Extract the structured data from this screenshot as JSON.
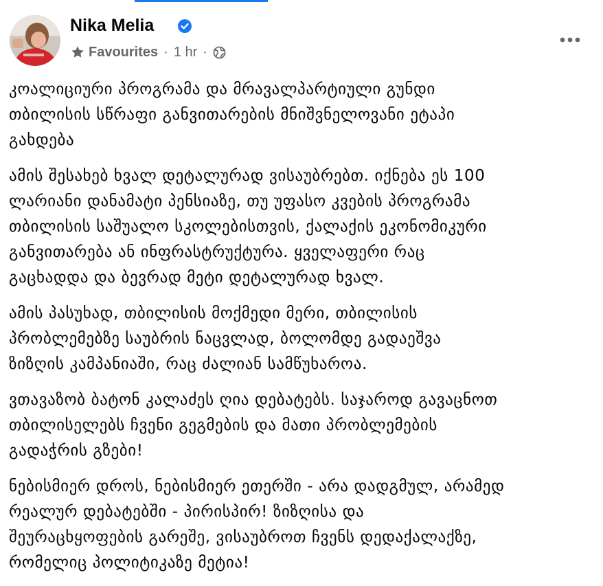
{
  "post": {
    "author": "Nika Melia",
    "verified": true,
    "audience_label": "Favourites",
    "separator": "·",
    "time": "1 hr",
    "more_icon": "more-horizontal-icon",
    "paragraphs": [
      "კოალიციური პროგრამა და მრავალპარტიული გუნდი\nთბილისის სწრაფი განვითარების მნიშვნელოვანი ეტაპი\nგახდება",
      "ამის შესახებ ხვალ დეტალურად ვისაუბრებთ. იქნება ეს 100\nლარიანი დანამატი პენსიაზე, თუ უფასო კვების პროგრამა\nთბილისის საშუალო სკოლებისთვის, ქალაქის ეკონომიკური\nგანვითარება ან ინფრასტრუქტურა. ყველაფერი რაც\nგაცხადდა და ბევრად მეტი დეტალურად ხვალ.",
      "ამის პასუხად, თბილისის მოქმედი მერი, თბილისის\nპრობლემებზე საუბრის ნაცვლად, ბოლომდე გადაეშვა\nზიზღის კამპანიაში, რაც ძალიან სამწუხაროა.",
      "ვთავაზობ ბატონ კალაძეს ღია დებატებს. საჯაროდ გავაცნოთ\nთბილისელებს ჩვენი გეგმების და მათი პრობლემების\nგადაჭრის გზები!",
      "ნებისმიერ დროს, ნებისმიერ ეთერში - არა დადგმულ, არამედ\nრეალურ დებატებში - პირისპირ! ზიზღისა და\nშეურაცხყოფების გარეშე, ვისაუბროთ ჩვენს დედაქალაქზე,\nრომელიც პოლიტიკაზე მეტია!"
    ]
  },
  "colors": {
    "accent": "#1877f2",
    "meta_text": "#65676b",
    "body_text": "#050505"
  }
}
